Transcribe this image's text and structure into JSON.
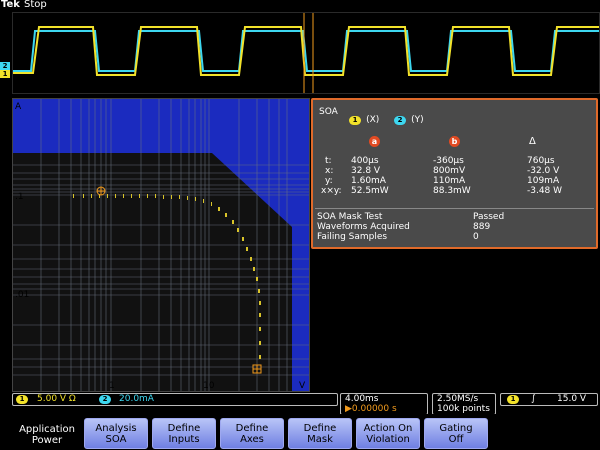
{
  "top": {
    "brand": "Tek",
    "status": "Stop",
    "markers": {
      "b": "b",
      "t": "T",
      "a": "a"
    }
  },
  "plot": {
    "y_axis_label": "A",
    "x_axis_label": "V",
    "y_ticks": [
      ".1",
      ".01"
    ],
    "x_ticks": [
      "1",
      "10"
    ]
  },
  "soa_panel": {
    "title": "SOA",
    "ch_x": {
      "badge": "1",
      "label": "(X)"
    },
    "ch_y": {
      "badge": "2",
      "label": "(Y)"
    },
    "col_a": "a",
    "col_b": "b",
    "col_delta": "Δ",
    "rows": [
      {
        "label": "t:",
        "a": "400µs",
        "b": "-360µs",
        "d": "760µs"
      },
      {
        "label": "x:",
        "a": "32.8 V",
        "b": "800mV",
        "d": "-32.0 V"
      },
      {
        "label": "y:",
        "a": "1.60mA",
        "b": "110mA",
        "d": "109mA"
      },
      {
        "label": "x×y:",
        "a": "52.5mW",
        "b": "88.3mW",
        "d": "-3.48 W"
      }
    ],
    "stats": [
      {
        "k": "SOA Mask Test",
        "v": "Passed"
      },
      {
        "k": "Waveforms Acquired",
        "v": "889"
      },
      {
        "k": "Failing Samples",
        "v": "0"
      }
    ]
  },
  "channels": {
    "ch1_badge": "1",
    "ch1_value": "5.00 V Ω",
    "ch2_badge": "2",
    "ch2_value": "20.0mA"
  },
  "timebase": {
    "time": "4.00ms",
    "trigger_pos": "▶0.00000 s",
    "rate": "2.50MS/s",
    "points": "100k points"
  },
  "trigger": {
    "badge": "1",
    "slope": "∫",
    "level": "15.0 V"
  },
  "softkeys": [
    {
      "title": "Application",
      "sub": "Power"
    },
    {
      "title": "Analysis",
      "sub": "SOA"
    },
    {
      "title": "Define",
      "sub": "Inputs"
    },
    {
      "title": "Define",
      "sub": "Axes"
    },
    {
      "title": "Define",
      "sub": "Mask"
    },
    {
      "title": "Action On",
      "sub": "Violation"
    },
    {
      "title": "Gating",
      "sub": "Off"
    }
  ],
  "colors": {
    "ch1": "#f2e22a",
    "ch2": "#3dd7f0",
    "panel_border": "#e06a2a",
    "softkey": "#7f8fe8"
  }
}
